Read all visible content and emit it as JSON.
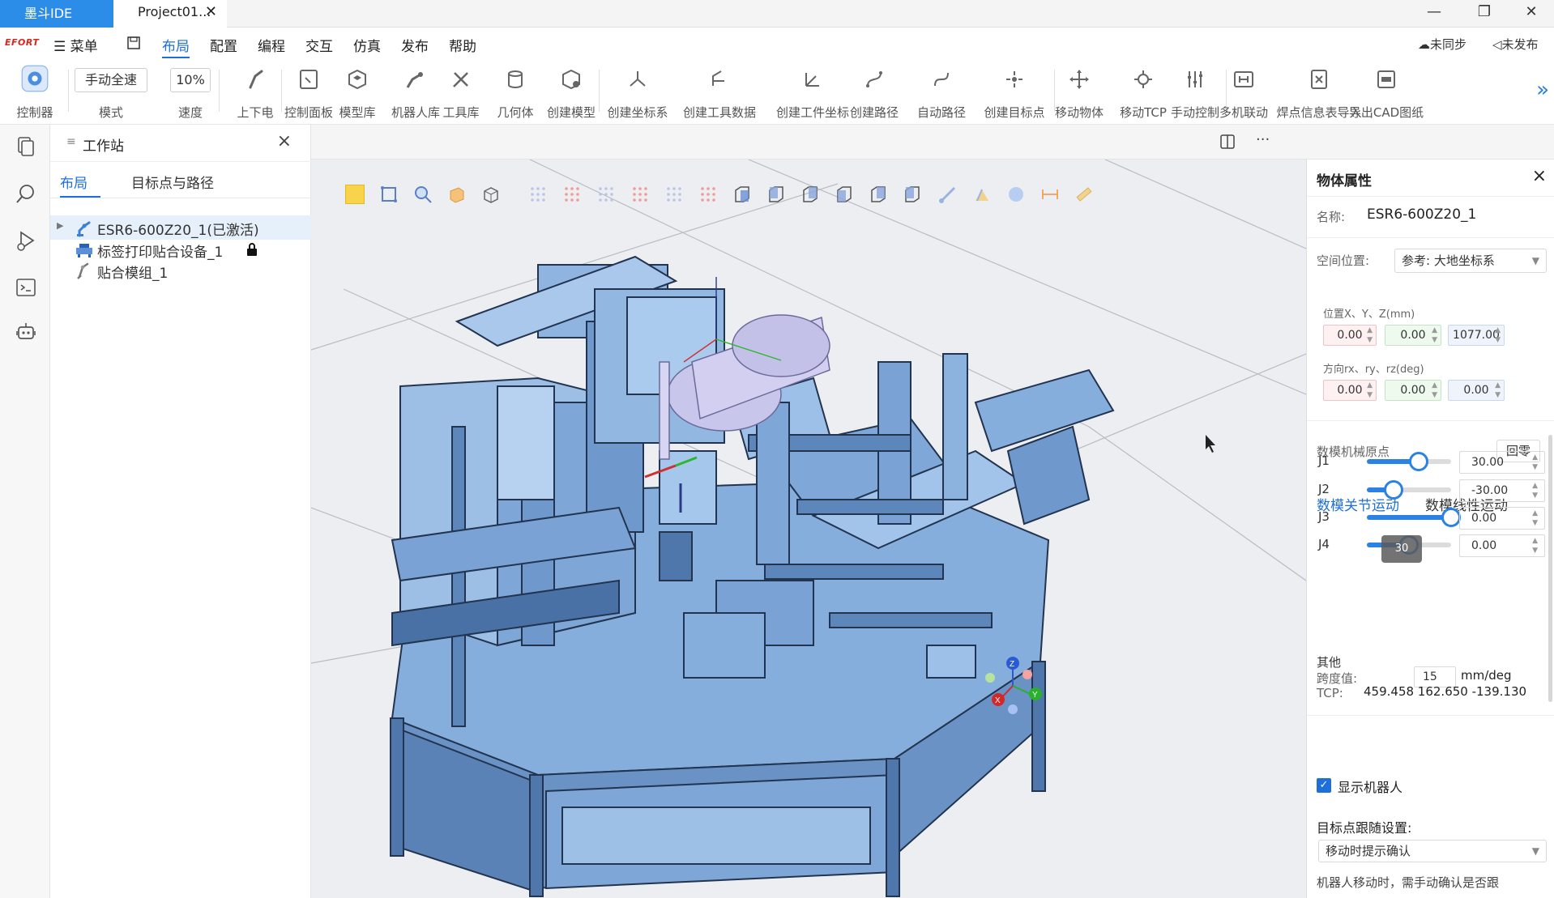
{
  "titlebar": {
    "app_tab": "墨斗IDE",
    "project_tab": "Project01...",
    "close": "✕",
    "minimize": "—",
    "restore": "❐",
    "window_close": "✕"
  },
  "menubar": {
    "logo": "EFORT",
    "menu": "菜单",
    "items": [
      "布局",
      "配置",
      "编程",
      "交互",
      "仿真",
      "发布",
      "帮助"
    ],
    "active": "布局",
    "sync_status": "未同步",
    "publish_status": "未发布"
  },
  "toolbar": {
    "controller": "控制器",
    "mode_value": "手动全速",
    "mode_label": "模式",
    "speed_value": "10%",
    "speed_label": "速度",
    "tools": [
      "上下电",
      "控制面板",
      "模型库",
      "机器人库",
      "工具库",
      "几何体",
      "创建模型",
      "创建坐标系",
      "创建工具数据",
      "创建工件坐标",
      "创建路径",
      "自动路径",
      "创建目标点",
      "移动物体",
      "移动TCP",
      "手动控制",
      "多机联动",
      "焊点信息表导入",
      "导出CAD图纸"
    ],
    "more": "»"
  },
  "panel": {
    "title": "工作站",
    "tabs": [
      "布局",
      "目标点与路径"
    ],
    "tree": [
      {
        "label": "ESR6-600Z20_1(已激活)"
      },
      {
        "label": "标签打印贴合设备_1"
      },
      {
        "label": "贴合模组_1"
      }
    ]
  },
  "props": {
    "title": "物体属性",
    "name_label": "名称:",
    "name_value": "ESR6-600Z20_1",
    "space_label": "空间位置:",
    "space_ref": "参考: 大地坐标系",
    "pos_label": "位置X、Y、Z(mm)",
    "pos": [
      "0.00",
      "0.00",
      "1077.00"
    ],
    "ori_label": "方向rx、ry、rz(deg)",
    "ori": [
      "0.00",
      "0.00",
      "0.00"
    ],
    "origin_label": "数模机械原点",
    "zero_button": "回零",
    "motion_tabs": [
      "数模关节运动",
      "数模线性运动"
    ],
    "joints": [
      {
        "name": "J1",
        "value": "30.00",
        "fraction": 0.62
      },
      {
        "name": "J2",
        "value": "-30.00",
        "fraction": 0.32
      },
      {
        "name": "J3",
        "value": "0.00",
        "fraction": 1.0
      },
      {
        "name": "J4",
        "value": "0.00",
        "fraction": 0.5
      }
    ],
    "tooltip": "30",
    "other_label": "其他",
    "span_label": "跨度值:",
    "span_value": "15",
    "span_unit": "mm/deg",
    "tcp_label": "TCP:",
    "tcp_value": "459.458 162.650 -139.130",
    "show_robot": "显示机器人",
    "follow_label": "目标点跟随设置:",
    "follow_value": "移动时提示确认",
    "follow_note": "机器人移动时，需手动确认是否跟"
  },
  "viewport": {
    "axis_labels": [
      "Z",
      "Y",
      "X"
    ]
  },
  "colors": {
    "accent": "#1e6fd9",
    "app_tab": "#2b8de8",
    "model": "#8ab4e0"
  }
}
